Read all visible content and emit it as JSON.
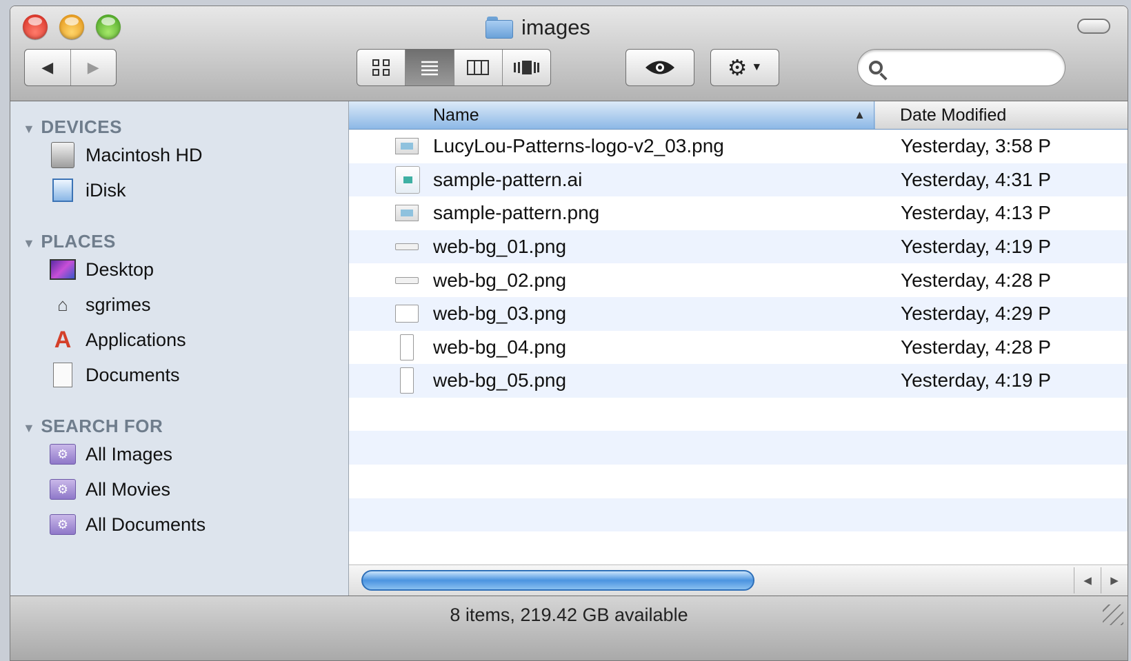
{
  "window": {
    "title": "images"
  },
  "toolbar": {
    "nav": {
      "back_icon": "back-arrow",
      "forward_icon": "forward-arrow"
    },
    "view_modes": [
      {
        "name": "icon-view",
        "glyph": "⊞",
        "active": false
      },
      {
        "name": "list-view",
        "glyph": "☰",
        "active": true
      },
      {
        "name": "column-view",
        "glyph": "◫",
        "active": false
      },
      {
        "name": "cover-flow-view",
        "glyph": "▥",
        "active": false
      }
    ],
    "quick_look_icon": "eye-icon",
    "action_icon": "gear-icon",
    "search": {
      "value": "",
      "placeholder": ""
    }
  },
  "sidebar": {
    "sections": [
      {
        "label": "DEVICES",
        "items": [
          {
            "label": "Macintosh HD",
            "icon": "hard-drive-icon"
          },
          {
            "label": "iDisk",
            "icon": "idisk-icon"
          }
        ]
      },
      {
        "label": "PLACES",
        "items": [
          {
            "label": "Desktop",
            "icon": "desktop-icon"
          },
          {
            "label": "sgrimes",
            "icon": "home-icon"
          },
          {
            "label": "Applications",
            "icon": "applications-icon"
          },
          {
            "label": "Documents",
            "icon": "documents-icon"
          }
        ]
      },
      {
        "label": "SEARCH FOR",
        "items": [
          {
            "label": "All Images",
            "icon": "smart-folder-icon"
          },
          {
            "label": "All Movies",
            "icon": "smart-folder-icon"
          },
          {
            "label": "All Documents",
            "icon": "smart-folder-icon"
          }
        ]
      }
    ]
  },
  "list": {
    "columns": [
      "Name",
      "Date Modified"
    ],
    "sort_indicator": "▲",
    "files": [
      {
        "name": "LucyLou-Patterns-logo-v2_03.png",
        "date": "Yesterday, 3:58 P"
      },
      {
        "name": "sample-pattern.ai",
        "date": "Yesterday, 4:31 P"
      },
      {
        "name": "sample-pattern.png",
        "date": "Yesterday, 4:13 P"
      },
      {
        "name": "web-bg_01.png",
        "date": "Yesterday, 4:19 P"
      },
      {
        "name": "web-bg_02.png",
        "date": "Yesterday, 4:28 P"
      },
      {
        "name": "web-bg_03.png",
        "date": "Yesterday, 4:29 P"
      },
      {
        "name": "web-bg_04.png",
        "date": "Yesterday, 4:28 P"
      },
      {
        "name": "web-bg_05.png",
        "date": "Yesterday, 4:19 P"
      }
    ]
  },
  "statusbar": {
    "text": "8 items, 219.42 GB available"
  }
}
